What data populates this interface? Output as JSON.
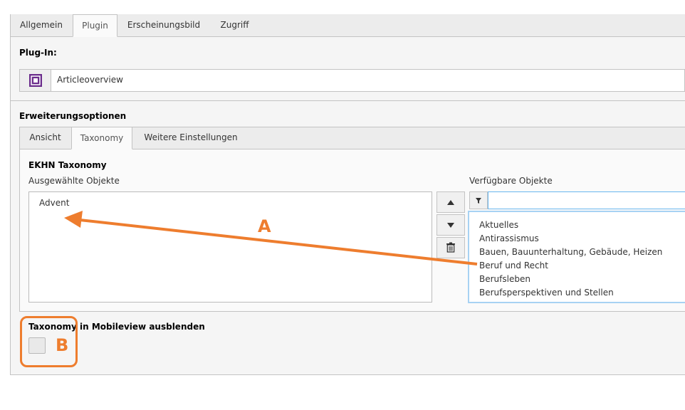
{
  "top_tabs": [
    "Allgemein",
    "Plugin",
    "Erscheinungsbild",
    "Zugriff"
  ],
  "plugin": {
    "label": "Plug-In:",
    "value": "Articleoverview",
    "icon": "plugin-icon"
  },
  "extension": {
    "label": "Erweiterungsoptionen",
    "tabs": [
      "Ansicht",
      "Taxonomy",
      "Weitere Einstellungen"
    ],
    "section_title": "EKHN Taxonomy",
    "selected_label": "Ausgewählte Objekte",
    "selected_items": [
      "Advent"
    ],
    "available_label": "Verfügbare Objekte",
    "filter_value": "",
    "available_items": [
      "Aktuelles",
      "Antirassismus",
      "Bauen, Bauunterhaltung, Gebäude, Heizen",
      "Beruf und Recht",
      "Berufsleben",
      "Berufsperspektiven und Stellen"
    ],
    "buttons": [
      "move-up-icon",
      "move-down-icon",
      "trash-icon"
    ]
  },
  "mobile_hide": {
    "label": "Taxonomy in Mobileview ausblenden",
    "checked": false
  },
  "annotations": {
    "a": "A",
    "b": "B",
    "color": "#ee7d2e"
  }
}
